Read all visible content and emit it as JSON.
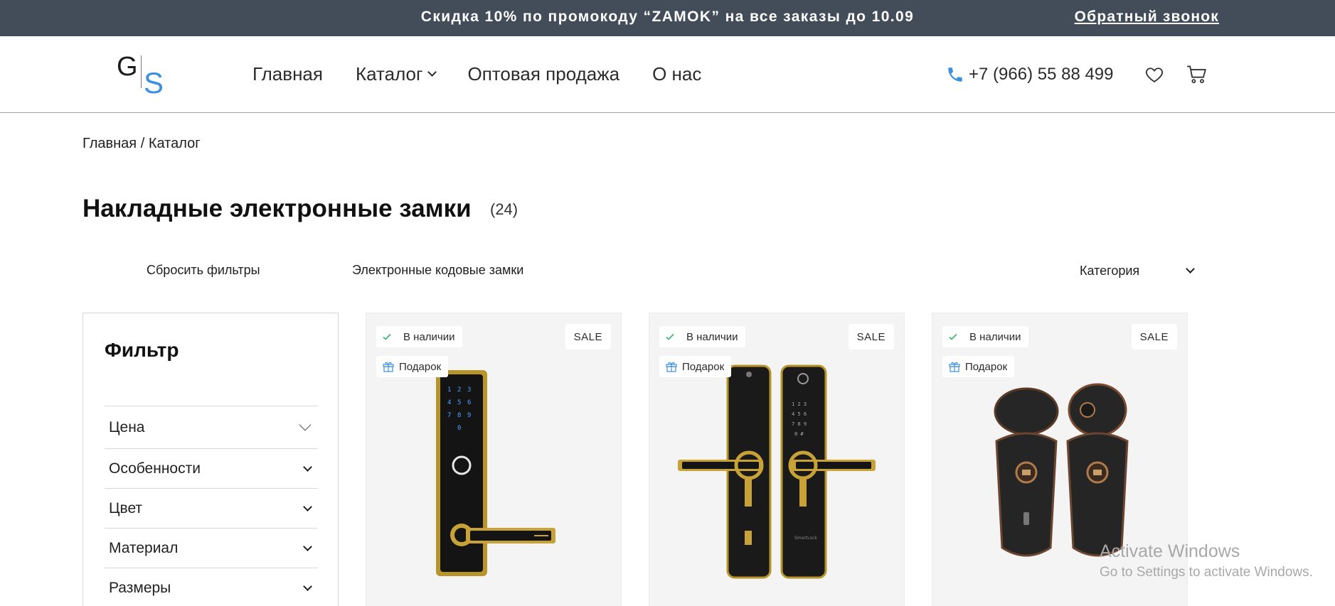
{
  "promo": {
    "text": "Скидка 10% по промокоду “ZAMOK” на все заказы до 10.09",
    "callback_link": "Обратный звонок"
  },
  "header": {
    "logo": {
      "letter_g": "G",
      "letter_s": "S",
      "accent_color": "#3d8fe0"
    },
    "nav": [
      "Главная",
      "Каталог",
      "Оптовая продажа",
      "О нас"
    ],
    "phone": "+7 (966) 55 88 499",
    "icons": [
      "phone-icon",
      "heart-icon",
      "cart-icon"
    ]
  },
  "breadcrumb": [
    "Главная",
    "/",
    "Каталог"
  ],
  "page": {
    "title": "Накладные электронные замки",
    "count": "(24)"
  },
  "toolbar": {
    "reset_filters": "Сбросить фильтры",
    "subcategory": "Электронные кодовые замки",
    "category_select": "Категория"
  },
  "sidebar": {
    "title": "Фильтр",
    "facets": [
      "Цена",
      "Особенности",
      "Цвет",
      "Материал",
      "Размеры"
    ]
  },
  "products": [
    {
      "stock": "В наличии",
      "gift": "Подарок",
      "sale": "SALE"
    },
    {
      "stock": "В наличии",
      "gift": "Подарок",
      "sale": "SALE"
    },
    {
      "stock": "В наличии",
      "gift": "Подарок",
      "sale": "SALE"
    }
  ],
  "watermark": {
    "line1": "Activate Windows",
    "line2": "Go to Settings to activate Windows."
  },
  "colors": {
    "promo_bg": "#434c59",
    "accent": "#3d8fe0",
    "card_bg": "#f4f4f4",
    "stock_check": "#3bb36b"
  }
}
